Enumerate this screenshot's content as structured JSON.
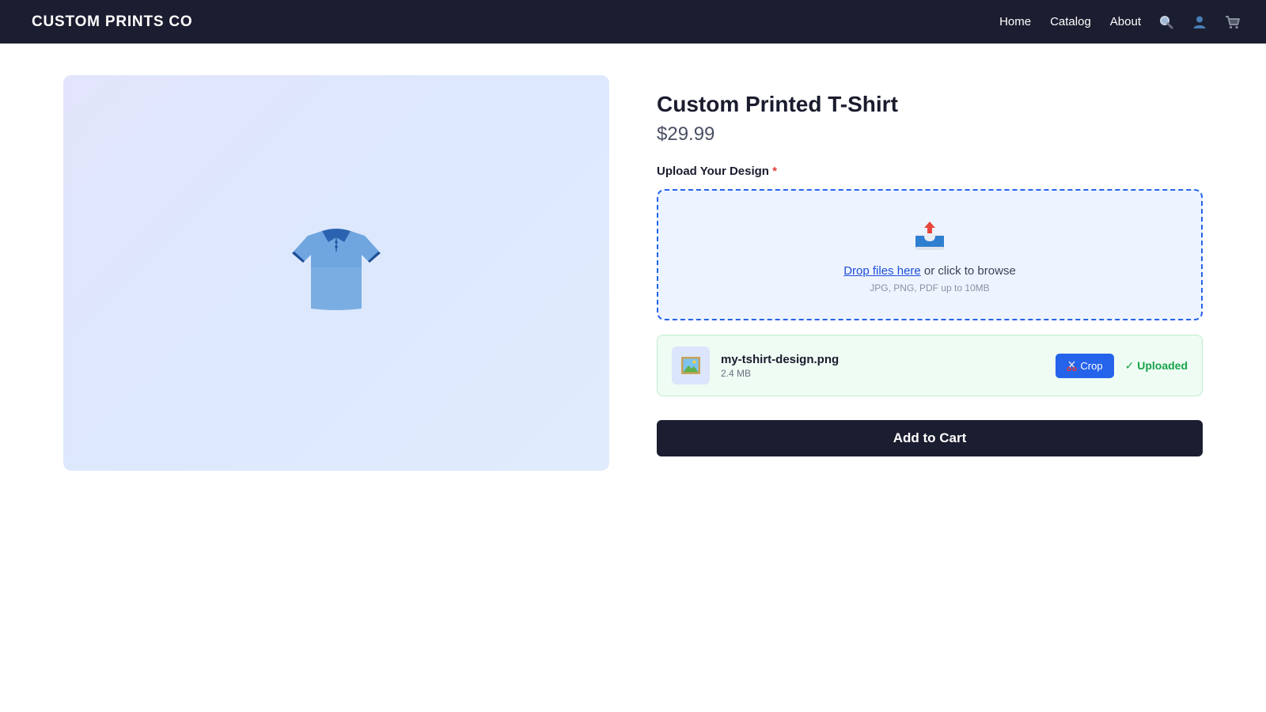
{
  "navbar": {
    "brand": "CUSTOM PRINTS CO",
    "links": [
      "Home",
      "Catalog",
      "About"
    ],
    "icons": [
      "search-icon",
      "user-icon",
      "cart-icon"
    ]
  },
  "product": {
    "image_icon": "t-shirt-icon",
    "title": "Custom Printed T-Shirt",
    "price": "$29.99"
  },
  "upload": {
    "label": "Upload Your Design",
    "required_mark": "*",
    "dropzone_icon": "inbox-upload-icon",
    "drop_link": "Drop files here",
    "drop_text": " or click to browse",
    "hint": "JPG, PNG, PDF up to 10MB"
  },
  "file": {
    "thumb_icon": "picture-icon",
    "name": "my-tshirt-design.png",
    "size": "2.4 MB",
    "crop_label": "Crop",
    "status": "✓ Uploaded"
  },
  "cart_button": "Add to Cart",
  "colors": {
    "nav_bg": "#1b1d30",
    "accent": "#2563eb",
    "success": "#16a34a",
    "required": "#e53e3e"
  }
}
